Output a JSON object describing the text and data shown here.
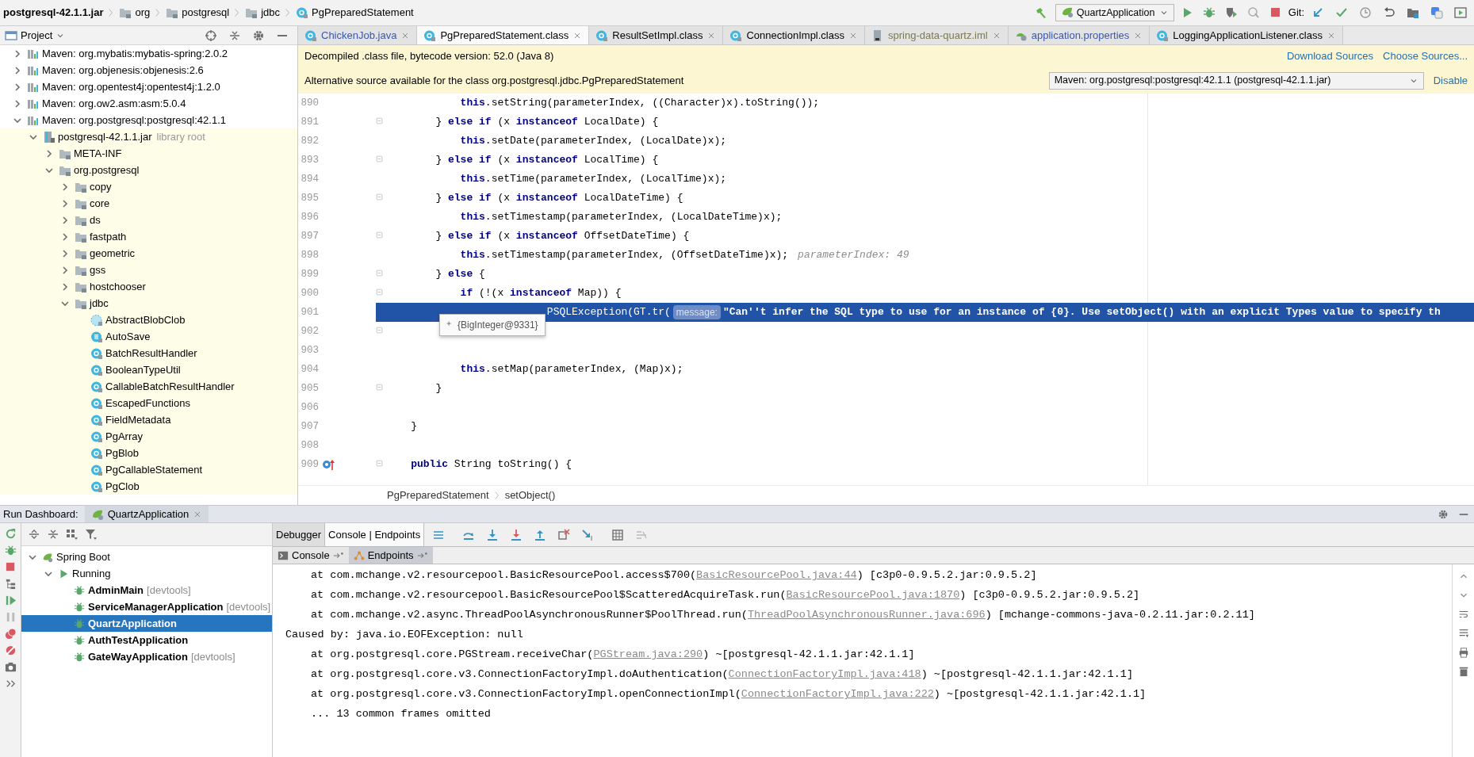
{
  "breadcrumb": [
    {
      "label": "postgresql-42.1.1.jar"
    },
    {
      "label": "org",
      "kind": "folder"
    },
    {
      "label": "postgresql",
      "kind": "folder"
    },
    {
      "label": "jdbc",
      "kind": "folder"
    },
    {
      "label": "PgPreparedStatement",
      "kind": "class"
    }
  ],
  "toolbar": {
    "run_config": "QuartzApplication",
    "git_label": "Git:"
  },
  "project_panel": {
    "title": "Project",
    "tree": [
      {
        "label": "Maven: org.mybatis:mybatis-spring:2.0.2",
        "kind": "library",
        "expanded": false
      },
      {
        "label": "Maven: org.objenesis:objenesis:2.6",
        "kind": "library",
        "expanded": false
      },
      {
        "label": "Maven: org.opentest4j:opentest4j:1.2.0",
        "kind": "library",
        "expanded": false
      },
      {
        "label": "Maven: org.ow2.asm:asm:5.0.4",
        "kind": "library",
        "expanded": false
      },
      {
        "label": "Maven: org.postgresql:postgresql:42.1.1",
        "kind": "library",
        "expanded": true,
        "children": [
          {
            "label": "postgresql-42.1.1.jar",
            "note": "library root",
            "kind": "jar",
            "expanded": true,
            "children": [
              {
                "label": "META-INF",
                "kind": "folder",
                "expanded": false
              },
              {
                "label": "org.postgresql",
                "kind": "folder",
                "expanded": true,
                "children": [
                  {
                    "label": "copy",
                    "kind": "folder",
                    "expanded": false
                  },
                  {
                    "label": "core",
                    "kind": "folder",
                    "expanded": false
                  },
                  {
                    "label": "ds",
                    "kind": "folder",
                    "expanded": false
                  },
                  {
                    "label": "fastpath",
                    "kind": "folder",
                    "expanded": false
                  },
                  {
                    "label": "geometric",
                    "kind": "folder",
                    "expanded": false
                  },
                  {
                    "label": "gss",
                    "kind": "folder",
                    "expanded": false
                  },
                  {
                    "label": "hostchooser",
                    "kind": "folder",
                    "expanded": false
                  },
                  {
                    "label": "jdbc",
                    "kind": "folder",
                    "expanded": true,
                    "children": [
                      {
                        "label": "AbstractBlobClob",
                        "kind": "abstract"
                      },
                      {
                        "label": "AutoSave",
                        "kind": "enum"
                      },
                      {
                        "label": "BatchResultHandler",
                        "kind": "class"
                      },
                      {
                        "label": "BooleanTypeUtil",
                        "kind": "class"
                      },
                      {
                        "label": "CallableBatchResultHandler",
                        "kind": "class"
                      },
                      {
                        "label": "EscapedFunctions",
                        "kind": "class"
                      },
                      {
                        "label": "FieldMetadata",
                        "kind": "class"
                      },
                      {
                        "label": "PgArray",
                        "kind": "class"
                      },
                      {
                        "label": "PgBlob",
                        "kind": "class"
                      },
                      {
                        "label": "PgCallableStatement",
                        "kind": "class"
                      },
                      {
                        "label": "PgClob",
                        "kind": "class"
                      }
                    ]
                  }
                ]
              }
            ]
          }
        ]
      }
    ]
  },
  "editor_tabs": [
    {
      "label": "ChickenJob.java",
      "kind": "class",
      "selected": false,
      "color": "#3b58a8"
    },
    {
      "label": "PgPreparedStatement.class",
      "kind": "class",
      "selected": true,
      "color": "#000000"
    },
    {
      "label": "ResultSetImpl.class",
      "kind": "class",
      "selected": false,
      "color": "#000000"
    },
    {
      "label": "ConnectionImpl.class",
      "kind": "class",
      "selected": false,
      "color": "#000000"
    },
    {
      "label": "spring-data-quartz.iml",
      "kind": "module",
      "selected": false,
      "color": "#7b7b52"
    },
    {
      "label": "application.properties",
      "kind": "properties",
      "selected": false,
      "color": "#3b58a8"
    },
    {
      "label": "LoggingApplicationListener.class",
      "kind": "class",
      "selected": false,
      "color": "#000000"
    }
  ],
  "notices": [
    {
      "text": "Decompiled .class file, bytecode version: 52.0 (Java 8)",
      "links": [
        "Download Sources",
        "Choose Sources..."
      ]
    },
    {
      "text": "Alternative source available for the class org.postgresql.jdbc.PgPreparedStatement",
      "select": "Maven: org.postgresql:postgresql:42.1.1 (postgresql-42.1.1.jar)",
      "links": [
        "Disable"
      ]
    }
  ],
  "code_lines": [
    {
      "number": "890",
      "code": "            **this**.setString(parameterIndex, ((Character)x).toString());",
      "fold": false,
      "highlighted": false
    },
    {
      "number": "891",
      "code": "        } **else if** (x **instanceof** LocalDate) {",
      "fold": true,
      "highlighted": false
    },
    {
      "number": "892",
      "code": "            **this**.setDate(parameterIndex, (LocalDate)x);",
      "fold": false,
      "highlighted": false
    },
    {
      "number": "893",
      "code": "        } **else if** (x **instanceof** LocalTime) {",
      "fold": true,
      "highlighted": false
    },
    {
      "number": "894",
      "code": "            **this**.setTime(parameterIndex, (LocalTime)x);",
      "fold": false,
      "highlighted": false
    },
    {
      "number": "895",
      "code": "        } **else if** (x **instanceof** LocalDateTime) {",
      "fold": true,
      "highlighted": false
    },
    {
      "number": "896",
      "code": "            **this**.setTimestamp(parameterIndex, (LocalDateTime)x);",
      "fold": false,
      "highlighted": false
    },
    {
      "number": "897",
      "code": "        } **else if** (x **instanceof** OffsetDateTime) {",
      "fold": true,
      "highlighted": false
    },
    {
      "number": "898",
      "code": "            **this**.setTimestamp(parameterIndex, (OffsetDateTime)x);",
      "hint": "parameterIndex: 49",
      "fold": false,
      "highlighted": false
    },
    {
      "number": "899",
      "code": "        } **else** {",
      "fold": true,
      "highlighted": false
    },
    {
      "number": "900",
      "code": "            **if** (!(x **instanceof** Map)) {",
      "fold": true,
      "highlighted": false
    },
    {
      "number": "901",
      "code": "                          PSQLException(GT.tr(",
      "inlay": "message:",
      "rest": "\"Can''t infer the SQL type to use for an instance of {0}. Use setObject() with an explicit Types value to specify th",
      "fold": false,
      "highlighted": true
    },
    {
      "number": "902",
      "fold": true,
      "highlighted": false
    },
    {
      "number": "903",
      "fold": false,
      "highlighted": false
    },
    {
      "number": "904",
      "code": "            **this**.setMap(parameterIndex, (Map)x);",
      "fold": false,
      "highlighted": false
    },
    {
      "number": "905",
      "code": "        }",
      "fold": true,
      "highlighted": false
    },
    {
      "number": "906",
      "fold": false,
      "highlighted": false
    },
    {
      "number": "907",
      "code": "    }",
      "fold": false,
      "highlighted": false
    },
    {
      "number": "908",
      "fold": false,
      "highlighted": false
    },
    {
      "number": "909",
      "code": "    **public** String toString() {",
      "fold": true,
      "highlighted": false,
      "overrides": true
    }
  ],
  "debug_tooltip": "{BigInteger@9331}",
  "editor_breadcrumb": [
    "PgPreparedStatement",
    "setObject()"
  ],
  "run_dashboard": {
    "title": "Run Dashboard:",
    "tab": "QuartzApplication",
    "tree": [
      {
        "label": "Spring Boot",
        "kind": "group",
        "expanded": true,
        "selected": false,
        "children": [
          {
            "label": "Running",
            "kind": "status",
            "expanded": true,
            "selected": false,
            "children": [
              {
                "label": "AdminMain",
                "tag": "[devtools]",
                "kind": "app",
                "selected": false
              },
              {
                "label": "ServiceManagerApplication",
                "tag": "[devtools]",
                "kind": "app",
                "selected": false
              },
              {
                "label": "QuartzApplication",
                "kind": "app",
                "selected": true
              },
              {
                "label": "AuthTestApplication",
                "kind": "app",
                "selected": false
              },
              {
                "label": "GateWayApplication",
                "tag": "[devtools]",
                "kind": "app",
                "selected": false
              }
            ]
          }
        ]
      }
    ],
    "tabs": [
      {
        "label": "Debugger",
        "selected": false
      },
      {
        "label": "Console | Endpoints",
        "selected": true
      }
    ],
    "subtabs": [
      {
        "label": "Console",
        "kind": "console",
        "selected": true
      },
      {
        "label": "Endpoints",
        "kind": "endpoints",
        "selected": false
      }
    ],
    "console": [
      {
        "kind": "frame",
        "parts": [
          {
            "kind": "text",
            "text": "at com.mchange.v2.resourcepool.BasicResourcePool.access$700("
          },
          {
            "kind": "link",
            "text": "BasicResourcePool.java:44"
          },
          {
            "kind": "text",
            "text": ") [c3p0-0.9.5.2.jar:0.9.5.2]"
          }
        ]
      },
      {
        "kind": "frame",
        "parts": [
          {
            "kind": "text",
            "text": "at com.mchange.v2.resourcepool.BasicResourcePool$ScatteredAcquireTask.run("
          },
          {
            "kind": "link",
            "text": "BasicResourcePool.java:1870"
          },
          {
            "kind": "text",
            "text": ") [c3p0-0.9.5.2.jar:0.9.5.2]"
          }
        ]
      },
      {
        "kind": "frame",
        "parts": [
          {
            "kind": "text",
            "text": "at com.mchange.v2.async.ThreadPoolAsynchronousRunner$PoolThread.run("
          },
          {
            "kind": "link",
            "text": "ThreadPoolAsynchronousRunner.java:696"
          },
          {
            "kind": "text",
            "text": ") [mchange-commons-java-0.2.11.jar:0.2.11]"
          }
        ]
      },
      {
        "kind": "cause",
        "parts": [
          {
            "kind": "text",
            "text": "Caused by: java.io.EOFException: null"
          }
        ]
      },
      {
        "kind": "frame",
        "parts": [
          {
            "kind": "text",
            "text": "at org.postgresql.core.PGStream.receiveChar("
          },
          {
            "kind": "link",
            "text": "PGStream.java:290"
          },
          {
            "kind": "text",
            "text": ") ~[postgresql-42.1.1.jar:42.1.1]"
          }
        ]
      },
      {
        "kind": "frame",
        "parts": [
          {
            "kind": "text",
            "text": "at org.postgresql.core.v3.ConnectionFactoryImpl.doAuthentication("
          },
          {
            "kind": "link",
            "text": "ConnectionFactoryImpl.java:418"
          },
          {
            "kind": "text",
            "text": ") ~[postgresql-42.1.1.jar:42.1.1]"
          }
        ]
      },
      {
        "kind": "frame",
        "parts": [
          {
            "kind": "text",
            "text": "at org.postgresql.core.v3.ConnectionFactoryImpl.openConnectionImpl("
          },
          {
            "kind": "link",
            "text": "ConnectionFactoryImpl.java:222"
          },
          {
            "kind": "text",
            "text": ") ~[postgresql-42.1.1.jar:42.1.1]"
          }
        ]
      },
      {
        "kind": "frame",
        "parts": [
          {
            "kind": "text",
            "text": "... 13 common frames omitted"
          }
        ]
      }
    ]
  }
}
